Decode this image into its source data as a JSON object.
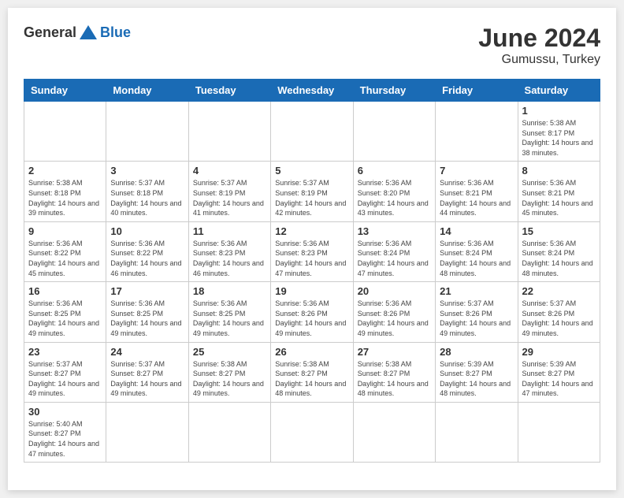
{
  "header": {
    "logo_general": "General",
    "logo_blue": "Blue",
    "month": "June 2024",
    "location": "Gumussu, Turkey"
  },
  "weekdays": [
    "Sunday",
    "Monday",
    "Tuesday",
    "Wednesday",
    "Thursday",
    "Friday",
    "Saturday"
  ],
  "days": {
    "d1": {
      "num": "1",
      "sunrise": "Sunrise: 5:38 AM",
      "sunset": "Sunset: 8:17 PM",
      "daylight": "Daylight: 14 hours and 38 minutes."
    },
    "d2": {
      "num": "2",
      "sunrise": "Sunrise: 5:38 AM",
      "sunset": "Sunset: 8:18 PM",
      "daylight": "Daylight: 14 hours and 39 minutes."
    },
    "d3": {
      "num": "3",
      "sunrise": "Sunrise: 5:37 AM",
      "sunset": "Sunset: 8:18 PM",
      "daylight": "Daylight: 14 hours and 40 minutes."
    },
    "d4": {
      "num": "4",
      "sunrise": "Sunrise: 5:37 AM",
      "sunset": "Sunset: 8:19 PM",
      "daylight": "Daylight: 14 hours and 41 minutes."
    },
    "d5": {
      "num": "5",
      "sunrise": "Sunrise: 5:37 AM",
      "sunset": "Sunset: 8:19 PM",
      "daylight": "Daylight: 14 hours and 42 minutes."
    },
    "d6": {
      "num": "6",
      "sunrise": "Sunrise: 5:36 AM",
      "sunset": "Sunset: 8:20 PM",
      "daylight": "Daylight: 14 hours and 43 minutes."
    },
    "d7": {
      "num": "7",
      "sunrise": "Sunrise: 5:36 AM",
      "sunset": "Sunset: 8:21 PM",
      "daylight": "Daylight: 14 hours and 44 minutes."
    },
    "d8": {
      "num": "8",
      "sunrise": "Sunrise: 5:36 AM",
      "sunset": "Sunset: 8:21 PM",
      "daylight": "Daylight: 14 hours and 45 minutes."
    },
    "d9": {
      "num": "9",
      "sunrise": "Sunrise: 5:36 AM",
      "sunset": "Sunset: 8:22 PM",
      "daylight": "Daylight: 14 hours and 45 minutes."
    },
    "d10": {
      "num": "10",
      "sunrise": "Sunrise: 5:36 AM",
      "sunset": "Sunset: 8:22 PM",
      "daylight": "Daylight: 14 hours and 46 minutes."
    },
    "d11": {
      "num": "11",
      "sunrise": "Sunrise: 5:36 AM",
      "sunset": "Sunset: 8:23 PM",
      "daylight": "Daylight: 14 hours and 46 minutes."
    },
    "d12": {
      "num": "12",
      "sunrise": "Sunrise: 5:36 AM",
      "sunset": "Sunset: 8:23 PM",
      "daylight": "Daylight: 14 hours and 47 minutes."
    },
    "d13": {
      "num": "13",
      "sunrise": "Sunrise: 5:36 AM",
      "sunset": "Sunset: 8:24 PM",
      "daylight": "Daylight: 14 hours and 47 minutes."
    },
    "d14": {
      "num": "14",
      "sunrise": "Sunrise: 5:36 AM",
      "sunset": "Sunset: 8:24 PM",
      "daylight": "Daylight: 14 hours and 48 minutes."
    },
    "d15": {
      "num": "15",
      "sunrise": "Sunrise: 5:36 AM",
      "sunset": "Sunset: 8:24 PM",
      "daylight": "Daylight: 14 hours and 48 minutes."
    },
    "d16": {
      "num": "16",
      "sunrise": "Sunrise: 5:36 AM",
      "sunset": "Sunset: 8:25 PM",
      "daylight": "Daylight: 14 hours and 49 minutes."
    },
    "d17": {
      "num": "17",
      "sunrise": "Sunrise: 5:36 AM",
      "sunset": "Sunset: 8:25 PM",
      "daylight": "Daylight: 14 hours and 49 minutes."
    },
    "d18": {
      "num": "18",
      "sunrise": "Sunrise: 5:36 AM",
      "sunset": "Sunset: 8:25 PM",
      "daylight": "Daylight: 14 hours and 49 minutes."
    },
    "d19": {
      "num": "19",
      "sunrise": "Sunrise: 5:36 AM",
      "sunset": "Sunset: 8:26 PM",
      "daylight": "Daylight: 14 hours and 49 minutes."
    },
    "d20": {
      "num": "20",
      "sunrise": "Sunrise: 5:36 AM",
      "sunset": "Sunset: 8:26 PM",
      "daylight": "Daylight: 14 hours and 49 minutes."
    },
    "d21": {
      "num": "21",
      "sunrise": "Sunrise: 5:37 AM",
      "sunset": "Sunset: 8:26 PM",
      "daylight": "Daylight: 14 hours and 49 minutes."
    },
    "d22": {
      "num": "22",
      "sunrise": "Sunrise: 5:37 AM",
      "sunset": "Sunset: 8:26 PM",
      "daylight": "Daylight: 14 hours and 49 minutes."
    },
    "d23": {
      "num": "23",
      "sunrise": "Sunrise: 5:37 AM",
      "sunset": "Sunset: 8:27 PM",
      "daylight": "Daylight: 14 hours and 49 minutes."
    },
    "d24": {
      "num": "24",
      "sunrise": "Sunrise: 5:37 AM",
      "sunset": "Sunset: 8:27 PM",
      "daylight": "Daylight: 14 hours and 49 minutes."
    },
    "d25": {
      "num": "25",
      "sunrise": "Sunrise: 5:38 AM",
      "sunset": "Sunset: 8:27 PM",
      "daylight": "Daylight: 14 hours and 49 minutes."
    },
    "d26": {
      "num": "26",
      "sunrise": "Sunrise: 5:38 AM",
      "sunset": "Sunset: 8:27 PM",
      "daylight": "Daylight: 14 hours and 48 minutes."
    },
    "d27": {
      "num": "27",
      "sunrise": "Sunrise: 5:38 AM",
      "sunset": "Sunset: 8:27 PM",
      "daylight": "Daylight: 14 hours and 48 minutes."
    },
    "d28": {
      "num": "28",
      "sunrise": "Sunrise: 5:39 AM",
      "sunset": "Sunset: 8:27 PM",
      "daylight": "Daylight: 14 hours and 48 minutes."
    },
    "d29": {
      "num": "29",
      "sunrise": "Sunrise: 5:39 AM",
      "sunset": "Sunset: 8:27 PM",
      "daylight": "Daylight: 14 hours and 47 minutes."
    },
    "d30": {
      "num": "30",
      "sunrise": "Sunrise: 5:40 AM",
      "sunset": "Sunset: 8:27 PM",
      "daylight": "Daylight: 14 hours and 47 minutes."
    }
  }
}
